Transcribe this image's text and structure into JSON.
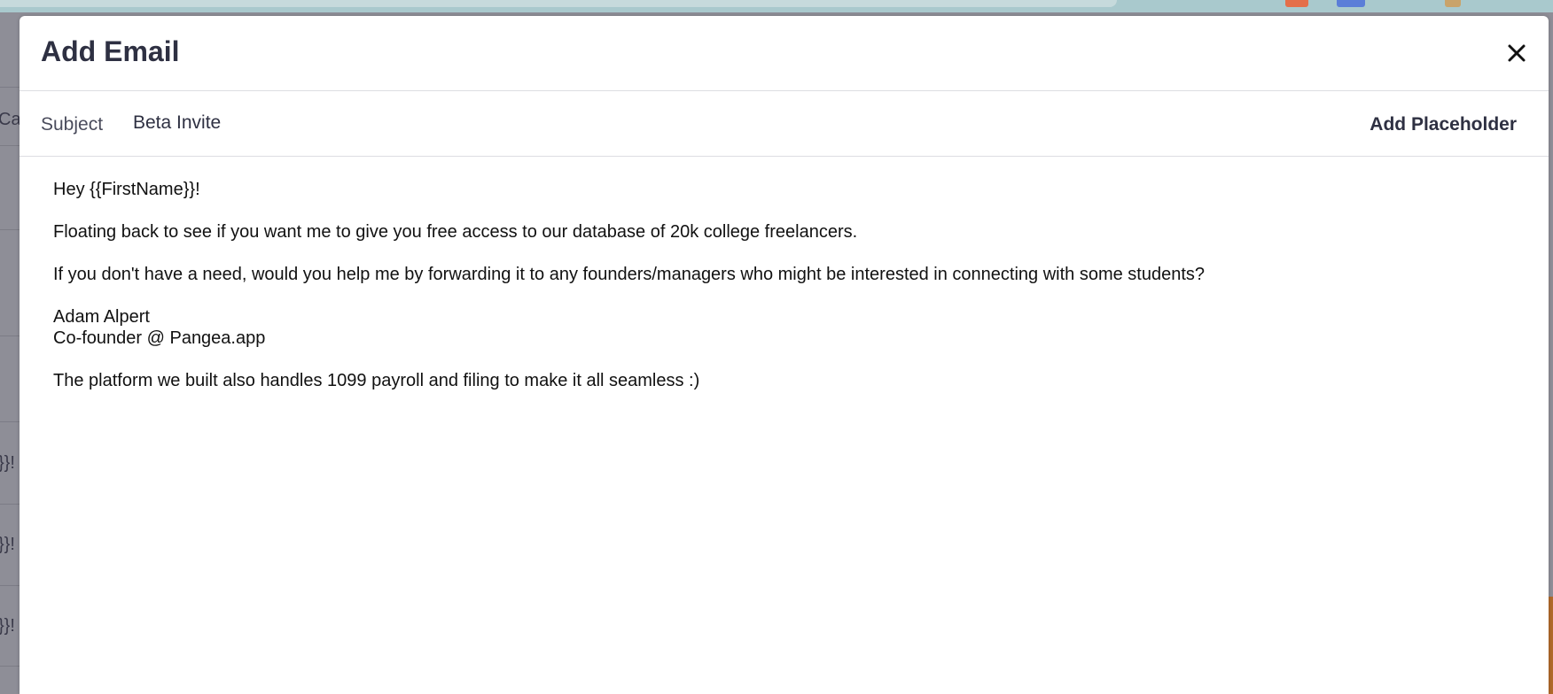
{
  "background": {
    "left_fragments": [
      "Ca",
      "}}!",
      "}}!",
      "}}!"
    ]
  },
  "modal": {
    "title": "Add Email",
    "close_icon": "close-icon",
    "subject": {
      "label": "Subject",
      "value": "Beta Invite"
    },
    "add_placeholder_label": "Add Placeholder",
    "body": {
      "greeting": "Hey {{FirstName}}!",
      "paragraph1": "Floating back to see if you want me to give you free access to our database of 20k college freelancers.",
      "paragraph2": "If you don't have a need, would you help me by forwarding it to any founders/managers who might be interested in connecting with some students?",
      "signature_name": "Adam Alpert",
      "signature_title": "Co-founder @ Pangea.app",
      "postscript": "The platform we built also handles 1099 payroll and filing to make it all seamless :)"
    }
  },
  "colors": {
    "overlay": "#8e8e97",
    "title_text": "#2e3042",
    "divider": "#dcdde2"
  }
}
